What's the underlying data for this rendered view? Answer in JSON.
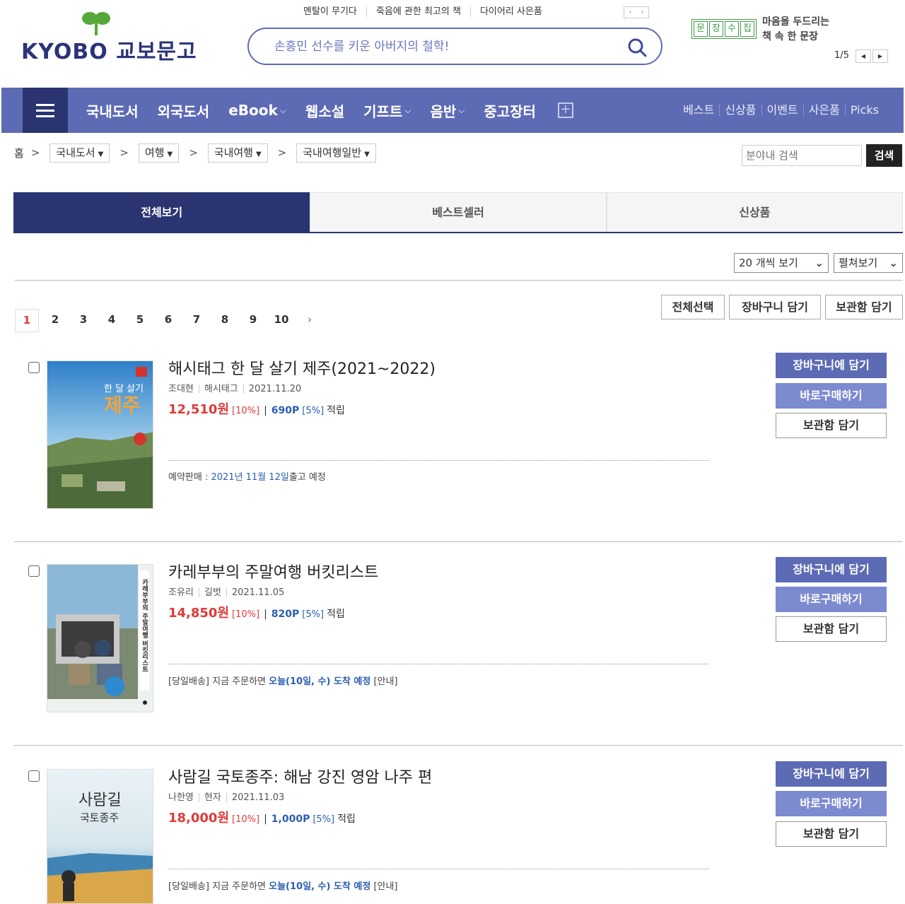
{
  "header": {
    "logo_text": "KYOBO 교보문고",
    "quicklinks": [
      "멘탈이 무기다",
      "죽음에 관한 최고의 책",
      "다이어리 사은품"
    ],
    "search_placeholder": "손흥민 선수를 키운 아버지의 철학!",
    "munjang_chars": [
      "문",
      "장",
      "수",
      "집"
    ],
    "munjang_line1": "마음을 두드리는",
    "munjang_line2": "책 속 한 문장",
    "munjang_page": "1/5"
  },
  "gnb": {
    "items": [
      {
        "label": "국내도서",
        "dropdown": false
      },
      {
        "label": "외국도서",
        "dropdown": false
      },
      {
        "label": "eBook",
        "dropdown": true
      },
      {
        "label": "웹소설",
        "dropdown": false
      },
      {
        "label": "기프트",
        "dropdown": true
      },
      {
        "label": "음반",
        "dropdown": true
      },
      {
        "label": "중고장터",
        "dropdown": false
      }
    ],
    "right_links": [
      "베스트",
      "신상품",
      "이벤트",
      "사은품",
      "Picks"
    ]
  },
  "breadcrumb": {
    "home": "홈",
    "levels": [
      "국내도서",
      "여행",
      "국내여행",
      "국내여행일반"
    ]
  },
  "field_search": {
    "placeholder": "분야내 검색",
    "button": "검색"
  },
  "tabs": [
    "전체보기",
    "베스트셀러",
    "신상품"
  ],
  "view_controls": {
    "per_page": "20 개씩 보기",
    "view_mode": "펼쳐보기"
  },
  "actions": [
    "전체선택",
    "장바구니 담기",
    "보관함 담기"
  ],
  "pagination": {
    "pages": [
      "1",
      "2",
      "3",
      "4",
      "5",
      "6",
      "7",
      "8",
      "9",
      "10"
    ],
    "current": "1",
    "next": "›"
  },
  "books": [
    {
      "title": "해시태그 한 달 살기 제주(2021~2022)",
      "author": "조대현",
      "publisher": "해시태그",
      "date": "2021.11.20",
      "price": "12,510원",
      "discount": "[10%]",
      "points": "690P",
      "points_rate": "[5%]",
      "accrue": "적립",
      "delivery_prefix": "예약판매 : ",
      "delivery_highlight": "2021년 11월 12일",
      "delivery_suffix": "출고 예정",
      "cover_text": "한 달 살기 제주",
      "cover_title": "제주",
      "cover_sub": "한 달 살기"
    },
    {
      "title": "카레부부의 주말여행 버킷리스트",
      "author": "조유리",
      "publisher": "길벗",
      "date": "2021.11.05",
      "price": "14,850원",
      "discount": "[10%]",
      "points": "820P",
      "points_rate": "[5%]",
      "accrue": "적립",
      "delivery_prefix": "[당일배송] 지금 주문하면 ",
      "delivery_highlight": "오늘(10일, 수) 도착 예정",
      "delivery_suffix": " [안내]",
      "cover_text": "카레부부의 주말여행 버킷리스트"
    },
    {
      "title": "사람길 국토종주: 해남 강진 영암 나주 편",
      "author": "나한영",
      "publisher": "현자",
      "date": "2021.11.03",
      "price": "18,000원",
      "discount": "[10%]",
      "points": "1,000P",
      "points_rate": "[5%]",
      "accrue": "적립",
      "delivery_prefix": "[당일배송] 지금 주문하면 ",
      "delivery_highlight": "오늘(10일, 수) 도착 예정",
      "delivery_suffix": " [안내]",
      "cover_title": "사람길",
      "cover_sub": "국토종주"
    }
  ],
  "book_buttons": {
    "cart": "장바구니에 담기",
    "buy": "바로구매하기",
    "keep": "보관함 담기"
  },
  "colors": {
    "brand": "#5d6bb5",
    "brand_dark": "#2a3470",
    "price": "#e03a3a",
    "points": "#2b5fb0"
  }
}
